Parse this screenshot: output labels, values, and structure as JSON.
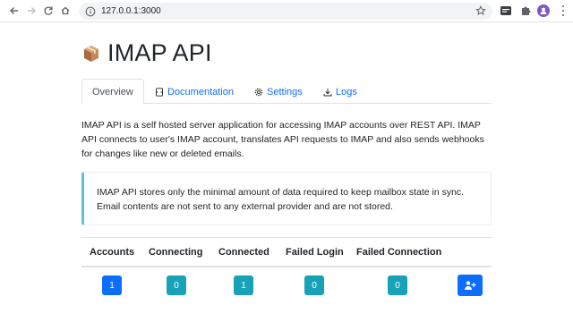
{
  "browser": {
    "url": "127.0.0.1:3000"
  },
  "page": {
    "title": "IMAP API",
    "tabs": [
      {
        "label": "Overview",
        "icon": "none",
        "active": true
      },
      {
        "label": "Documentation",
        "icon": "document-icon",
        "active": false
      },
      {
        "label": "Settings",
        "icon": "gear-icon",
        "active": false
      },
      {
        "label": "Logs",
        "icon": "download-icon",
        "active": false
      }
    ],
    "intro": "IMAP API is a self hosted server application for accessing IMAP accounts over REST API. IMAP API connects to user's IMAP account, translates API requests to IMAP and also sends webhooks for changes like new or deleted emails.",
    "note": "IMAP API stores only the minimal amount of data required to keep mailbox state in sync. Email contents are not sent to any external provider and are not stored.",
    "stats": {
      "headers": [
        "Accounts",
        "Connecting",
        "Connected",
        "Failed Login",
        "Failed Connection"
      ],
      "values": [
        "1",
        "0",
        "1",
        "0",
        "0"
      ]
    }
  },
  "colors": {
    "primary": "#0d6efd",
    "info": "#17a2b8",
    "note_border": "#5bc0de"
  }
}
